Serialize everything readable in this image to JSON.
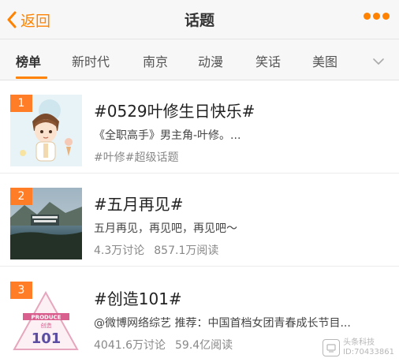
{
  "nav": {
    "back_label": "返回",
    "title": "话题"
  },
  "tabs": [
    "榜单",
    "新时代",
    "南京",
    "动漫",
    "笑话",
    "美图"
  ],
  "active_tab": "榜单",
  "accent_color": "#ff8200",
  "rank_badge_color": "#ff7d26",
  "items": [
    {
      "rank": "1",
      "title": "#0529叶修生日快乐#",
      "desc": "《全职高手》男主角-叶修。...",
      "tags": "#叶修#超级话题"
    },
    {
      "rank": "2",
      "title": "#五月再见#",
      "desc": "五月再见，再见吧，再见吧～",
      "discuss": "4.3万讨论",
      "reads": "857.1万阅读"
    },
    {
      "rank": "3",
      "title": "#创造101#",
      "desc": "@微博网络综艺 推荐：中国首档女团青春成长节目...",
      "discuss": "4041.6万讨论",
      "reads": "59.4亿阅读",
      "logo_text": "PRODUCE 创造 101"
    }
  ],
  "watermark": {
    "line1": "头条科技",
    "line2": "ID:70433861"
  }
}
